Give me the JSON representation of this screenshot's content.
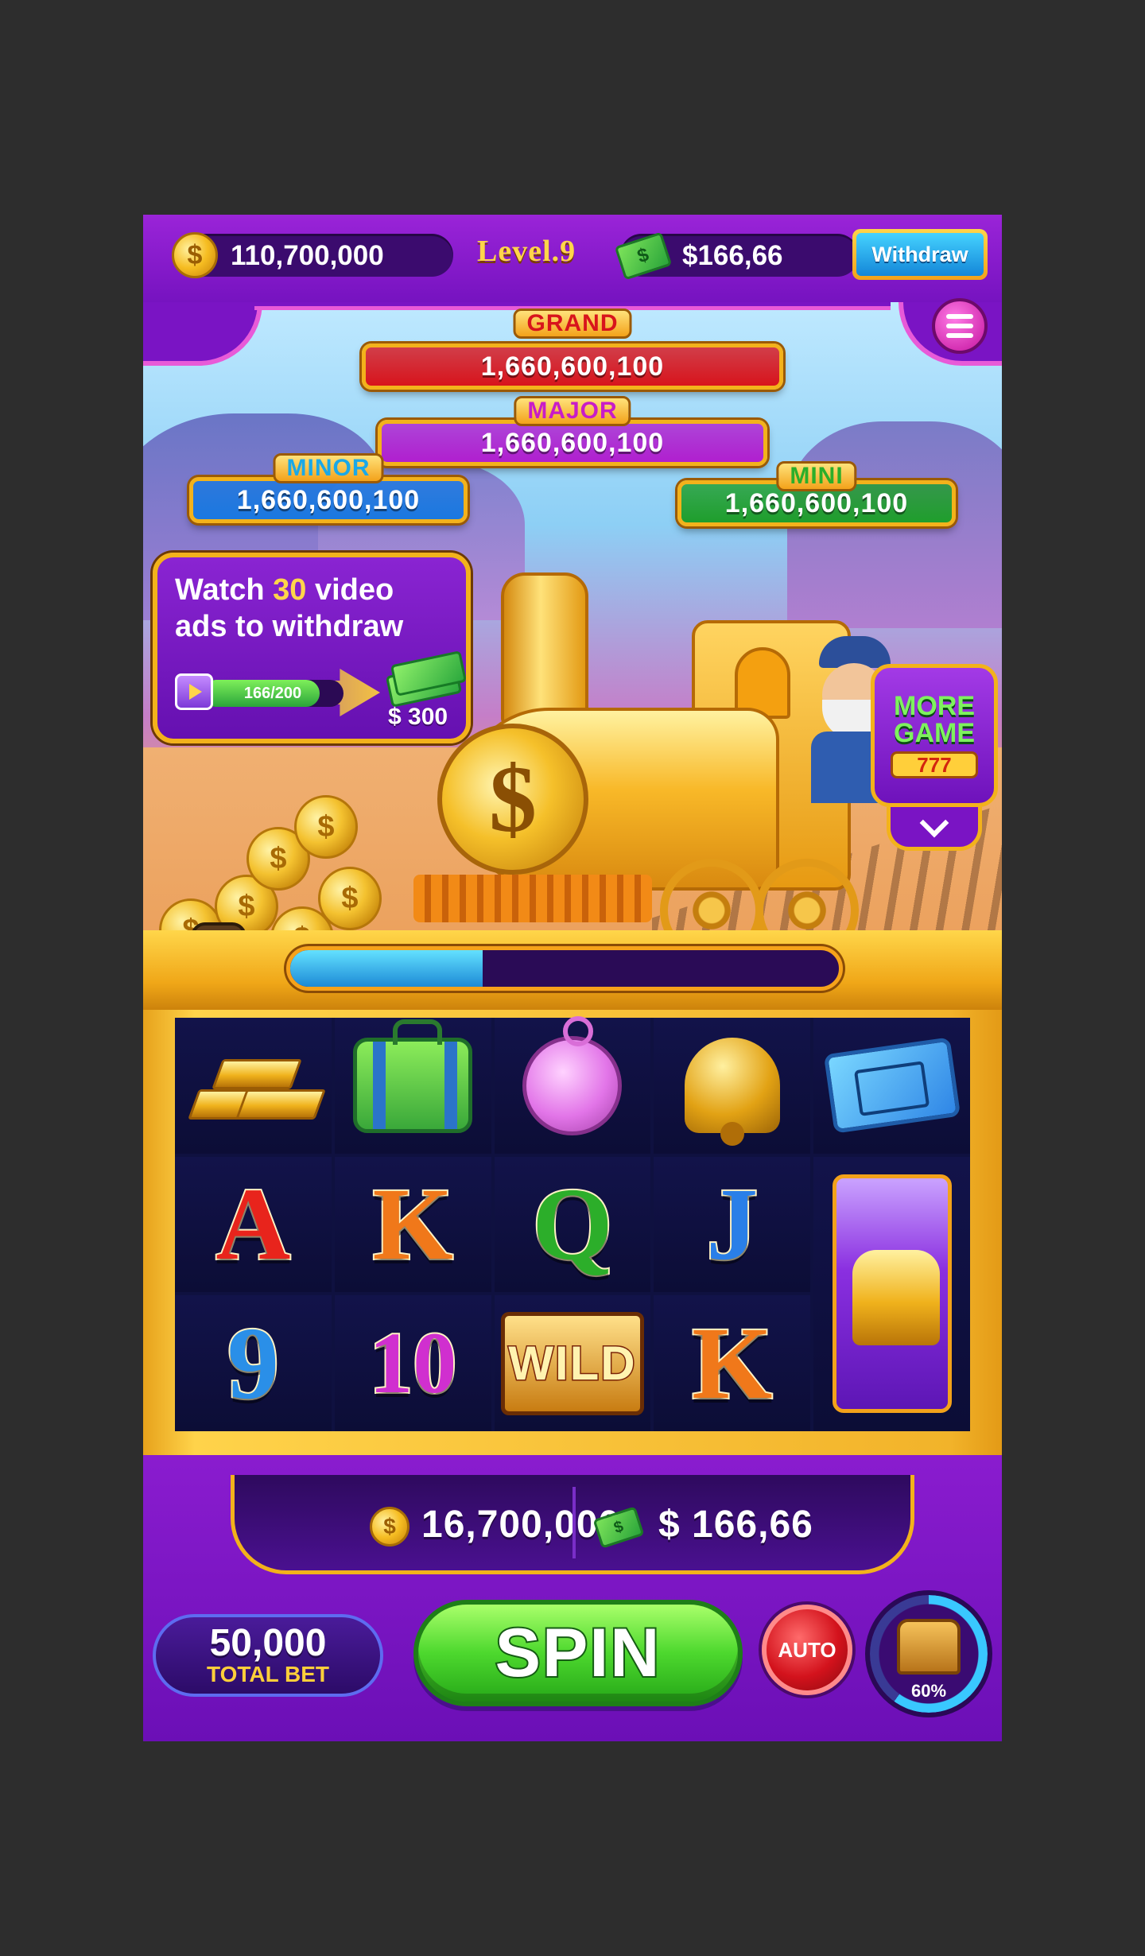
{
  "header": {
    "coins": "110,700,000",
    "level": "Level.9",
    "cash": "$166,66",
    "withdraw_label": "Withdraw"
  },
  "jackpots": {
    "grand": {
      "label": "GRAND",
      "value": "1,660,600,100",
      "color": "#d8141c",
      "label_color": "#d8141c"
    },
    "major": {
      "label": "MAJOR",
      "value": "1,660,600,100",
      "color": "#b01fcf",
      "label_color": "#c81cc8"
    },
    "minor": {
      "label": "MINOR",
      "value": "1,660,600,100",
      "color": "#1a78e0",
      "label_color": "#1aa8e8"
    },
    "mini": {
      "label": "MINI",
      "value": "1,660,600,100",
      "color": "#1f9e2c",
      "label_color": "#2cae2a"
    }
  },
  "ad_panel": {
    "line1_prefix": "Watch ",
    "highlight": "30",
    "line1_suffix": " video",
    "line2": "ads to withdraw",
    "progress_label": "166/200",
    "progress_fraction": 0.83,
    "reward": "$ 300"
  },
  "more_game": {
    "line1": "MORE",
    "line2": "GAME",
    "sevens": "777"
  },
  "rail_progress_fraction": 0.35,
  "reels": {
    "rows": [
      [
        "gold-bars",
        "suitcase",
        "pocket-watch",
        "bell",
        "ticket"
      ],
      [
        "A",
        "K",
        "Q",
        "J",
        "scatter-train"
      ],
      [
        "9",
        "10",
        "WILD",
        "K",
        "scatter-train"
      ]
    ],
    "letter_colors": {
      "A": "#e8241c",
      "K": "#f0781a",
      "Q": "#2cae2a",
      "J": "#2a7fe8",
      "9": "#2a8fe8",
      "10": "#d02fcf"
    }
  },
  "bottom": {
    "coin_total": "16,700,000",
    "cash_total": "$ 166,66",
    "bet_value": "50,000",
    "bet_label": "TOTAL BET",
    "spin_label": "SPIN",
    "auto_label": "AUTO",
    "chest_percent": "60%",
    "chest_fraction": 0.6
  }
}
